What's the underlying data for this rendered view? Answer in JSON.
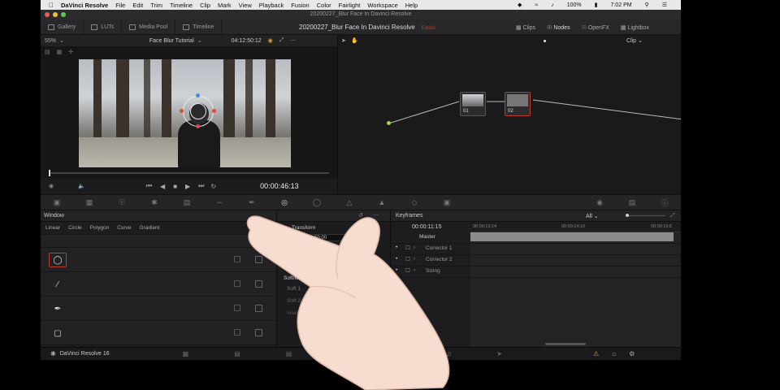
{
  "menubar": {
    "app_name": "DaVinci Resolve",
    "items": [
      "File",
      "Edit",
      "Trim",
      "Timeline",
      "Clip",
      "Mark",
      "View",
      "Playback",
      "Fusion",
      "Color",
      "Fairlight",
      "Workspace",
      "Help"
    ],
    "battery": "100%",
    "clock": "7:02 PM"
  },
  "window": {
    "title": "20200227_Blur Face In Davinci Resolve"
  },
  "toolbar": {
    "gallery": "Gallery",
    "luts": "LUTs",
    "media_pool": "Media Pool",
    "timeline": "Timeline",
    "project_title": "20200227_Blur Face In Davinci Resolve",
    "edited": "Edited",
    "clips": "Clips",
    "nodes": "Nodes",
    "openfx": "OpenFX",
    "lightbox": "Lightbox"
  },
  "viewer": {
    "zoom": "55%",
    "timeline_name": "Face Blur Tutorial",
    "timecode_top": "04:12:50:12",
    "timecode": "00:00:46:13"
  },
  "node_editor": {
    "mode": "Clip",
    "nodes": [
      {
        "label": "01"
      },
      {
        "label": "02"
      }
    ]
  },
  "window_panel": {
    "title": "Window",
    "shapes": [
      "Linear",
      "Circle",
      "Polygon",
      "Curve",
      "Gradient"
    ]
  },
  "transform_panel": {
    "title": "Transform",
    "value": "50.00",
    "softness_label": "Softness",
    "soft1": "Soft 1",
    "soft2": "Soft 2",
    "inside": "Inside"
  },
  "keyframes": {
    "title": "Keyframes",
    "filter": "All",
    "timecode": "00:00:11:15",
    "ruler": [
      "00:00:13:14",
      "00:00:14:10",
      "00:00:15:0"
    ],
    "rows": [
      "Master",
      "Corrector 1",
      "Corrector 2",
      "Sizing"
    ]
  },
  "bottombar": {
    "app_label": "DaVinci Resolve 16"
  }
}
